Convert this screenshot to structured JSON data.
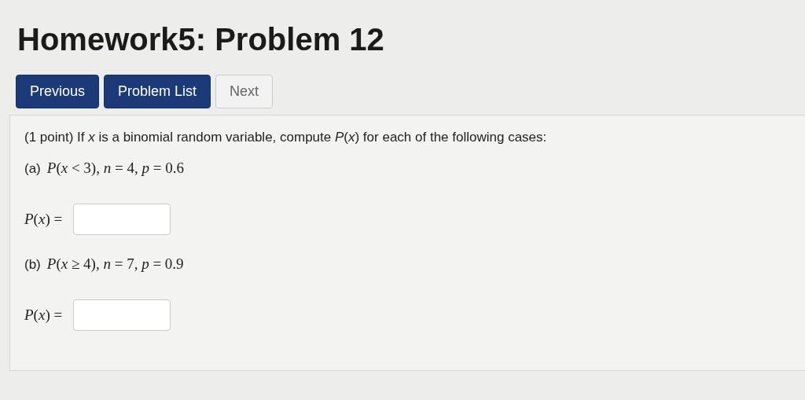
{
  "page_title": "Homework5: Problem 12",
  "nav_buttons": [
    {
      "label": "Previous",
      "disabled": false
    },
    {
      "label": "Problem List",
      "disabled": false
    },
    {
      "label": "Next",
      "disabled": true
    }
  ],
  "problem": {
    "intro": "(1 point) If *x* is a binomial random variable, compute *P*(*x*) for each of the following cases:",
    "parts": [
      {
        "label": "(a)",
        "expression": "*P*(*x* < 3), *n* = 4, *p* = 0.6",
        "answer_label": "*P*(*x*) ="
      },
      {
        "label": "(b)",
        "expression": "*P*(*x* ≥ 4), *n* = 7, *p* = 0.9",
        "answer_label": "*P*(*x*) ="
      }
    ]
  }
}
